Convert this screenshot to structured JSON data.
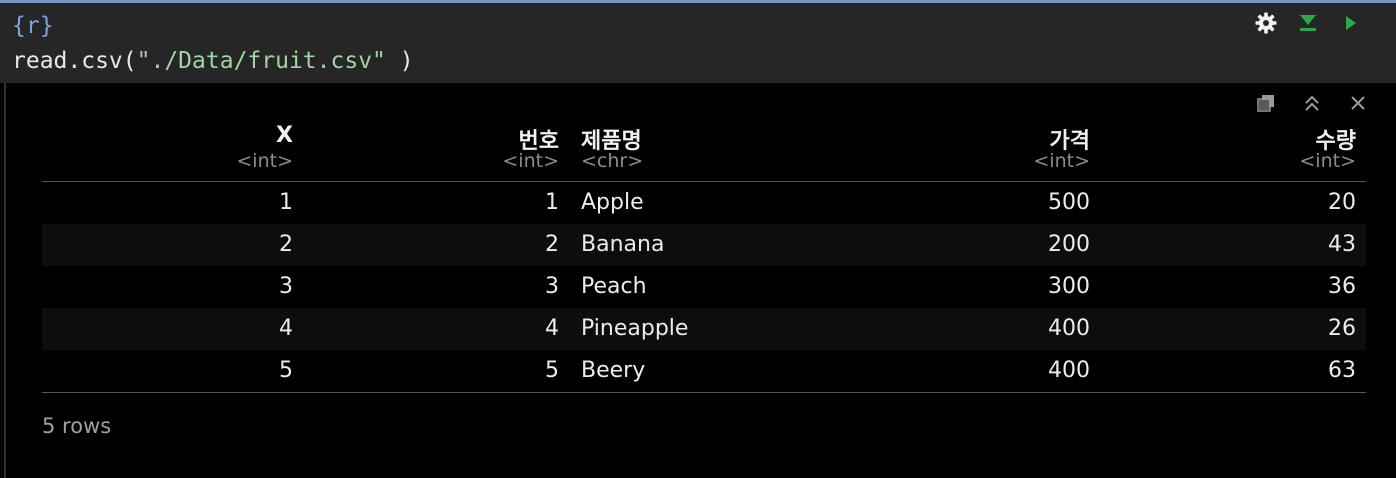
{
  "editor": {
    "chunk_header": "{r}",
    "code": {
      "func": "read.csv",
      "open": "(",
      "arg": "\"./Data/fruit.csv\"",
      "close": " )"
    },
    "tools": {
      "settings_icon": "gear-icon",
      "run_above_icon": "run-previous-chunks-icon",
      "run_chunk_icon": "play-icon",
      "accent_green": "#2aa84a"
    }
  },
  "output": {
    "tools": {
      "popout_icon": "open-in-window-icon",
      "collapse_icon": "chevron-double-up-icon",
      "close_icon": "close-icon"
    },
    "columns": [
      {
        "name": "X",
        "type": "<int>"
      },
      {
        "name": "번호",
        "type": "<int>"
      },
      {
        "name": "제품명",
        "type": "<chr>"
      },
      {
        "name": "가격",
        "type": "<int>"
      },
      {
        "name": "수량",
        "type": "<int>"
      }
    ],
    "rows": [
      [
        "1",
        "1",
        "Apple",
        "500",
        "20"
      ],
      [
        "2",
        "2",
        "Banana",
        "200",
        "43"
      ],
      [
        "3",
        "3",
        "Peach",
        "300",
        "36"
      ],
      [
        "4",
        "4",
        "Pineapple",
        "400",
        "26"
      ],
      [
        "5",
        "5",
        "Beery",
        "400",
        "63"
      ]
    ],
    "footer": "5 rows"
  }
}
